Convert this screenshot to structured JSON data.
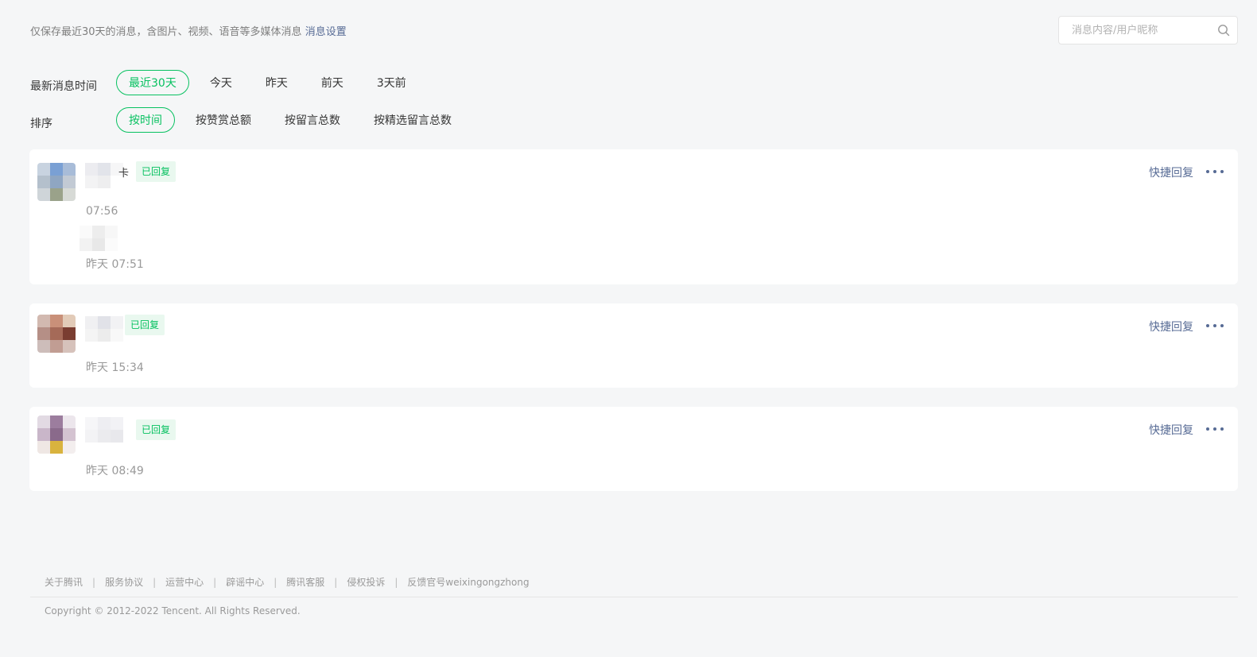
{
  "notice": {
    "text": "仅保存最近30天的消息，含图片、视频、语音等多媒体消息",
    "settings_link": "消息设置"
  },
  "search": {
    "placeholder": "消息内容/用户昵称",
    "icon": "search-icon"
  },
  "filters": {
    "time": {
      "label": "最新消息时间",
      "options": [
        "最近30天",
        "今天",
        "昨天",
        "前天",
        "3天前"
      ],
      "selected": "最近30天"
    },
    "sort": {
      "label": "排序",
      "options": [
        "按时间",
        "按赞赏总额",
        "按留言总数",
        "按精选留言总数"
      ],
      "selected": "按时间"
    }
  },
  "messages": [
    {
      "nickname_fragment": "卡",
      "badge": "已回复",
      "time": "07:56",
      "reply_time": "昨天 07:51",
      "quick_reply": "快捷回复",
      "more_icon": "more-icon"
    },
    {
      "badge": "已回复",
      "time": "昨天 15:34",
      "quick_reply": "快捷回复",
      "more_icon": "more-icon"
    },
    {
      "badge": "已回复",
      "time": "昨天 08:49",
      "quick_reply": "快捷回复",
      "more_icon": "more-icon"
    }
  ],
  "footer": {
    "links": [
      "关于腾讯",
      "服务协议",
      "运营中心",
      "辟谣中心",
      "腾讯客服",
      "侵权投诉",
      "反馈官号weixingongzhong"
    ],
    "copyright": "Copyright © 2012-2022 Tencent. All Rights Reserved."
  },
  "colors": {
    "accent_green": "#07c160",
    "link_blue": "#576b95",
    "background": "#f5f6f7",
    "badge_bg": "#e9f8ef"
  }
}
